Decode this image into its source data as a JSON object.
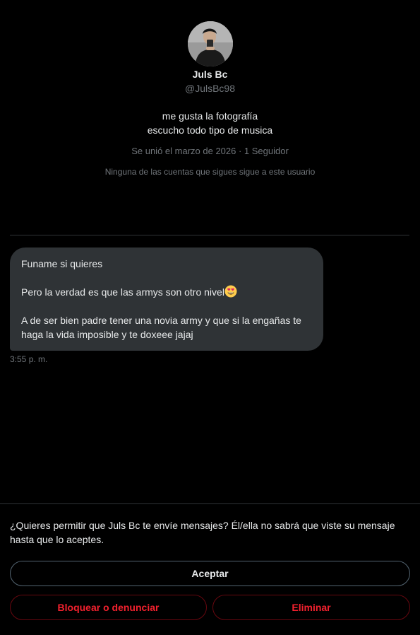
{
  "profile": {
    "display_name": "Juls Bc",
    "handle": "@JulsBc98",
    "bio_lines": [
      "me gusta la fotografía",
      "escucho todo tipo de musica"
    ],
    "joined": "Se unió el marzo de 2026 · 1 Seguidor",
    "follow_note": "Ninguna de las cuentas que sigues sigue a este usuario"
  },
  "message": {
    "paragraphs": [
      "Funame si quieres",
      "Pero la verdad es que las armys son otro nivel",
      "A de ser bien padre tener una novia army y que si la engañas te haga la vida imposible y te doxeee jajaj"
    ],
    "emoji": "smiling-face-with-heart-eyes",
    "timestamp": "3:55 p. m."
  },
  "request": {
    "prompt": "¿Quieres permitir que Juls Bc te envíe mensajes? Él/ella no sabrá que viste su mensaje hasta que lo aceptes.",
    "accept_label": "Aceptar",
    "block_label": "Bloquear o denunciar",
    "delete_label": "Eliminar"
  },
  "colors": {
    "background": "#000000",
    "bubble": "#2f3336",
    "muted_text": "#71767b",
    "danger": "#f4212e"
  }
}
